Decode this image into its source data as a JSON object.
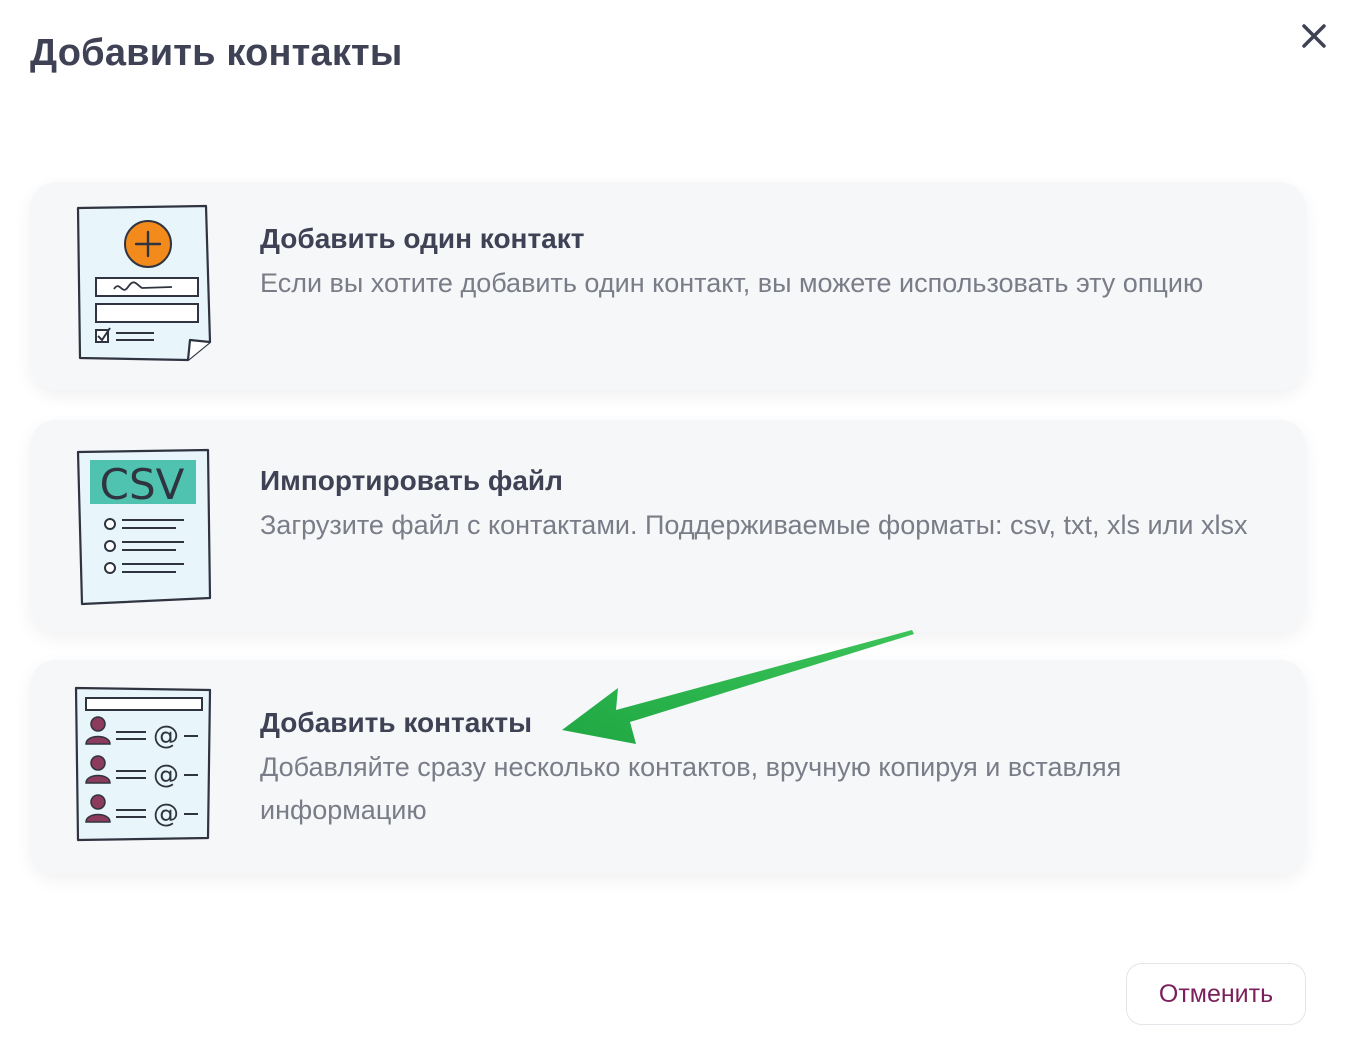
{
  "modal": {
    "title": "Добавить контакты",
    "close_icon": "close-icon"
  },
  "options": [
    {
      "title": "Добавить один контакт",
      "description": "Если вы хотите добавить один контакт, вы можете использовать эту опцию",
      "icon": "single-contact-form-illustration"
    },
    {
      "title": "Импортировать файл",
      "description": "Загрузите файл с контактами. Поддерживаемые форматы: csv, txt, xls или xlsx",
      "icon": "csv-file-illustration",
      "icon_text": "CSV"
    },
    {
      "title": "Добавить контакты",
      "description": "Добавляйте сразу несколько контактов, вручную копируя и вставляя информацию",
      "icon": "contact-list-illustration"
    }
  ],
  "annotation": {
    "icon": "green-arrow-pointer",
    "color": "#22b14c"
  },
  "footer": {
    "cancel_label": "Отменить"
  },
  "colors": {
    "title": "#3f4254",
    "description": "#7a7d88",
    "card_bg": "#f5f7f9",
    "accent": "#7a1f5c",
    "plus_circle": "#f28a1c",
    "csv_band": "#4fc3b0"
  }
}
